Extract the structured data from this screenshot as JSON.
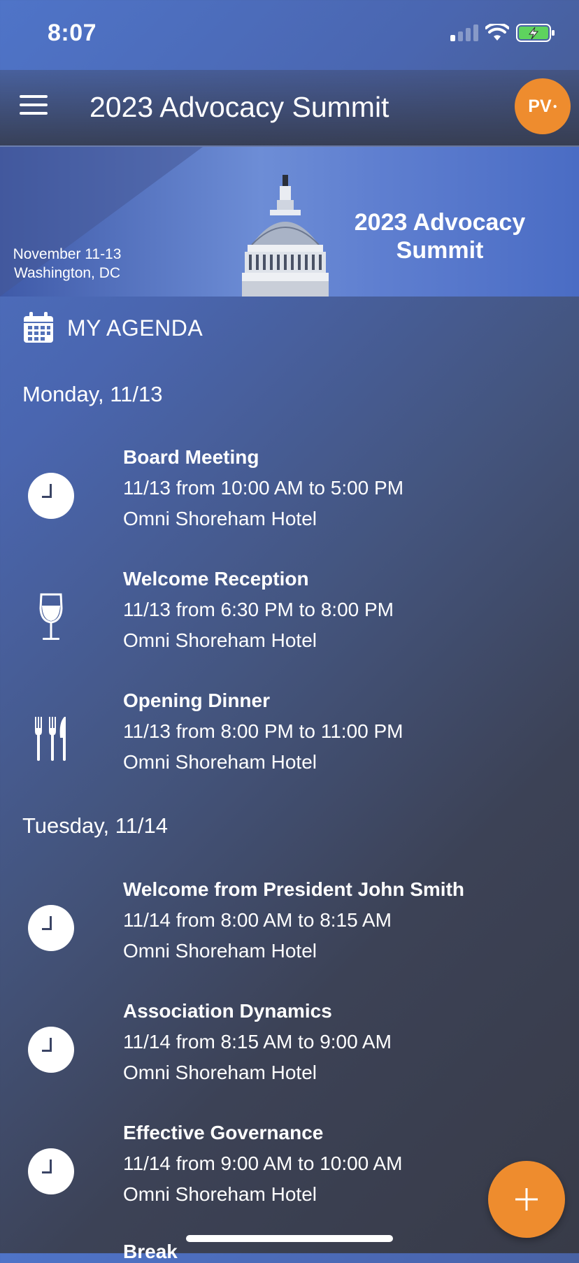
{
  "status_bar": {
    "time": "8:07"
  },
  "app_bar": {
    "title": "2023 Advocacy Summit",
    "avatar_initials": "PV"
  },
  "banner": {
    "date_line1": "November 11-13",
    "date_line2": "Washington, DC",
    "title_line1": "2023 Advocacy",
    "title_line2": "Summit"
  },
  "section": {
    "icon": "calendar-icon",
    "label": "MY AGENDA"
  },
  "days": [
    {
      "label": "Monday, 11/13",
      "events": [
        {
          "icon": "clock-icon",
          "title": "Board Meeting",
          "time": "11/13 from 10:00 AM to 5:00 PM",
          "location": "Omni Shoreham Hotel"
        },
        {
          "icon": "wine-glass-icon",
          "title": "Welcome Reception",
          "time": "11/13 from 6:30 PM to 8:00 PM",
          "location": "Omni Shoreham Hotel"
        },
        {
          "icon": "utensils-icon",
          "title": "Opening Dinner",
          "time": "11/13 from 8:00 PM to 11:00 PM",
          "location": "Omni Shoreham Hotel"
        }
      ]
    },
    {
      "label": "Tuesday, 11/14",
      "events": [
        {
          "icon": "clock-icon",
          "title": "Welcome from President John Smith",
          "time": "11/14 from 8:00 AM to 8:15 AM",
          "location": "Omni Shoreham Hotel"
        },
        {
          "icon": "clock-icon",
          "title": "Association Dynamics",
          "time": "11/14 from 8:15 AM to 9:00 AM",
          "location": "Omni Shoreham Hotel"
        },
        {
          "icon": "clock-icon",
          "title": "Effective Governance",
          "time": "11/14 from 9:00 AM to 10:00 AM",
          "location": "Omni Shoreham Hotel"
        },
        {
          "title": "Break"
        }
      ]
    }
  ],
  "colors": {
    "accent": "#ee8c2e"
  }
}
